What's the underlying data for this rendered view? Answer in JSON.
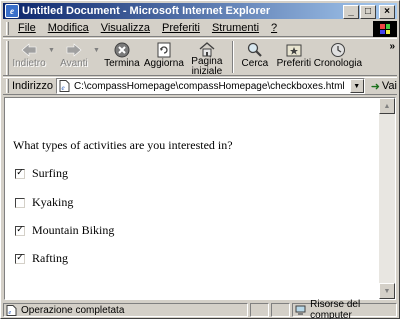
{
  "window": {
    "title": "Untitled Document - Microsoft Internet Explorer",
    "controls": {
      "minimize": "_",
      "maximize": "□",
      "close": "×"
    }
  },
  "menu": {
    "items": [
      {
        "label": "File",
        "mnemonic": "F"
      },
      {
        "label": "Modifica",
        "mnemonic": "M"
      },
      {
        "label": "Visualizza",
        "mnemonic": "V"
      },
      {
        "label": "Preferiti",
        "mnemonic": "P"
      },
      {
        "label": "Strumenti",
        "mnemonic": "S"
      },
      {
        "label": "?",
        "mnemonic": "?"
      }
    ]
  },
  "toolbar": {
    "back": {
      "label": "Indietro",
      "icon": "back-arrow-icon",
      "enabled": false
    },
    "forward": {
      "label": "Avanti",
      "icon": "forward-arrow-icon",
      "enabled": false
    },
    "stop": {
      "label": "Termina",
      "icon": "stop-icon"
    },
    "refresh": {
      "label": "Aggiorna",
      "icon": "refresh-icon"
    },
    "home": {
      "label": "Pagina iniziale",
      "icon": "home-icon"
    },
    "search": {
      "label": "Cerca",
      "icon": "search-icon"
    },
    "favorites": {
      "label": "Preferiti",
      "icon": "favorites-icon"
    },
    "history": {
      "label": "Cronologia",
      "icon": "history-icon"
    },
    "more": "»"
  },
  "address": {
    "label": "Indirizzo",
    "url": "C:\\compassHomepage\\compassHomepage\\checkboxes.html",
    "go_label": "Vai"
  },
  "page": {
    "question": "What types of activities are you interested in?",
    "options": [
      {
        "label": "Surfing",
        "checked": true
      },
      {
        "label": "Kyaking",
        "checked": false
      },
      {
        "label": "Mountain Biking",
        "checked": true
      },
      {
        "label": "Rafting",
        "checked": true
      }
    ]
  },
  "status": {
    "text": "Operazione completata",
    "zone": "Risorse del computer"
  },
  "colors": {
    "titlebar_start": "#0a246a",
    "titlebar_end": "#a6caf0",
    "chrome": "#d4d0c8"
  }
}
